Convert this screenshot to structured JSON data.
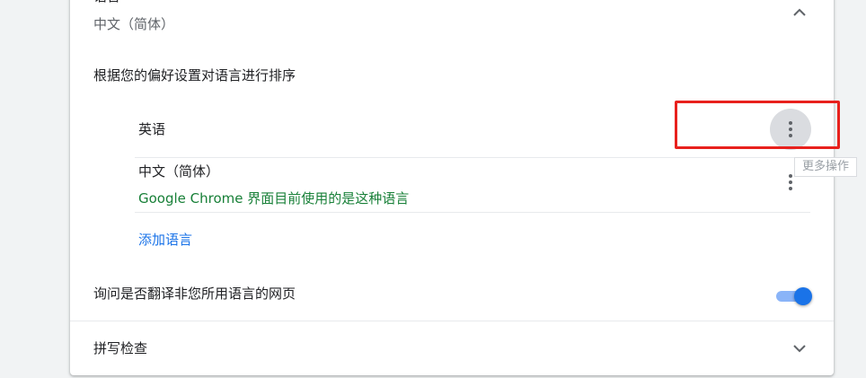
{
  "language_section": {
    "title": "语言",
    "current_value": "中文（简体）",
    "sort_label": "根据您的偏好设置对语言进行排序",
    "languages": [
      {
        "name": "英语",
        "note": ""
      },
      {
        "name": "中文（简体）",
        "note": "Google Chrome 界面目前使用的是这种语言"
      }
    ],
    "add_language": "添加语言",
    "more_actions_tooltip": "更多操作",
    "translate_offer_label": "询问是否翻译非您所用语言的网页",
    "translate_offer_enabled": true
  },
  "spellcheck_section": {
    "title": "拼写检查"
  },
  "icons": {
    "collapse": "chevron-up-icon",
    "expand": "chevron-down-icon",
    "menu": "more-vert-icon"
  },
  "colors": {
    "accent": "#1a73e8",
    "green_note": "#188038",
    "highlight": "#e8211d"
  }
}
